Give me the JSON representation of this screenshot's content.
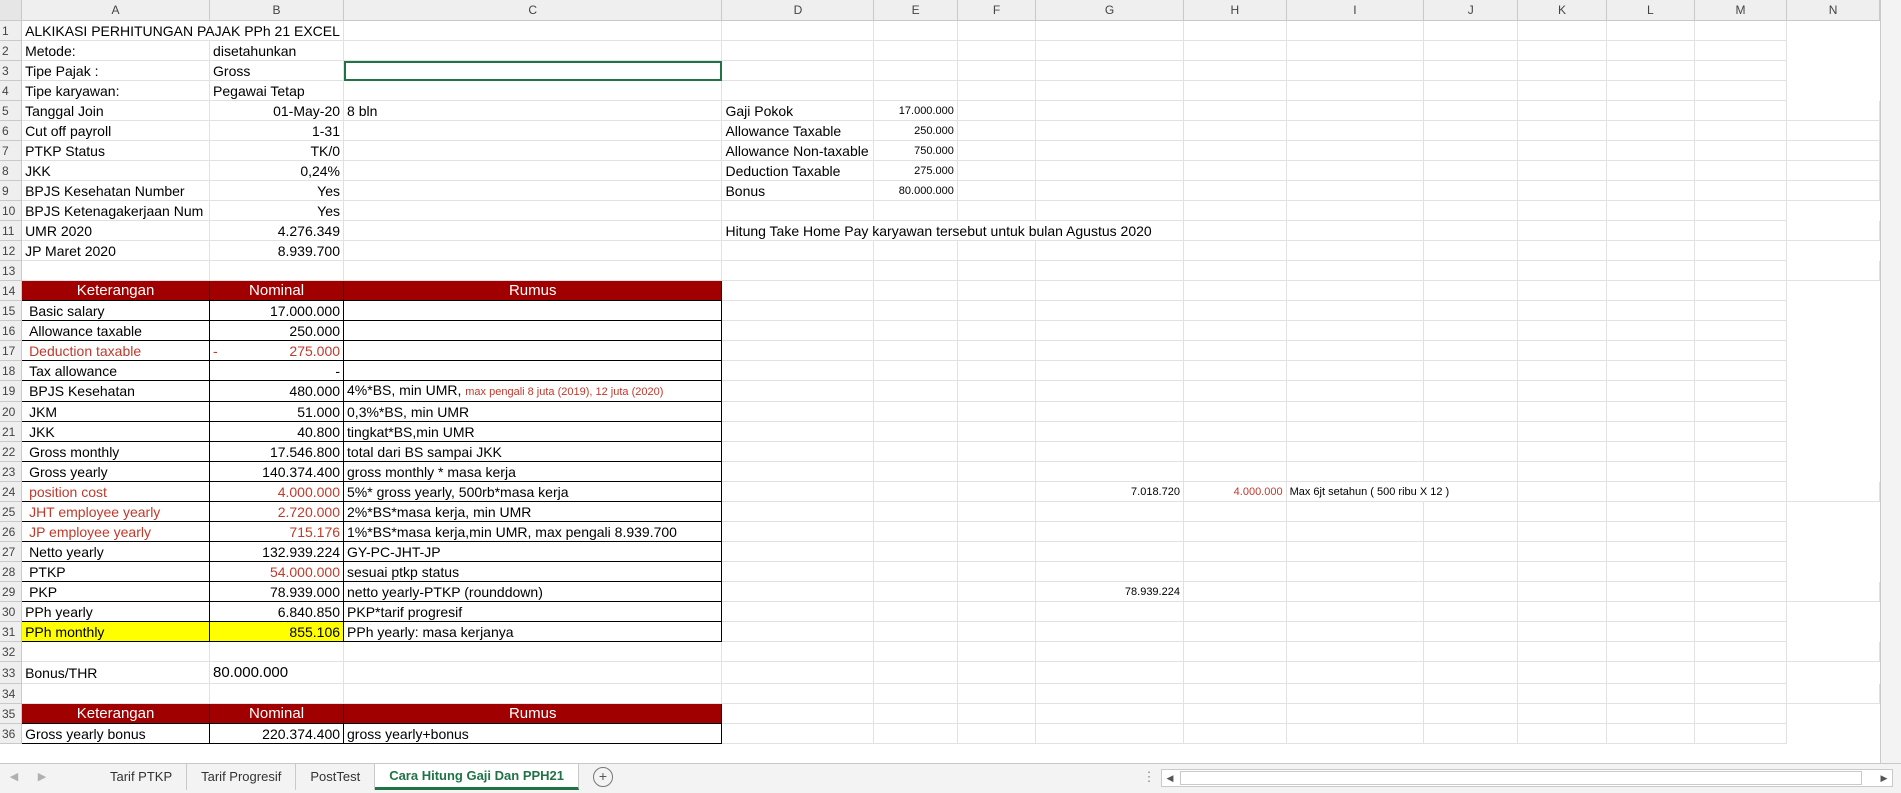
{
  "columns": [
    "A",
    "B",
    "C",
    "D",
    "E",
    "F",
    "G",
    "H",
    "I",
    "J",
    "K",
    "L",
    "M",
    "N"
  ],
  "rows": [
    "1",
    "2",
    "3",
    "4",
    "5",
    "6",
    "7",
    "8",
    "9",
    "10",
    "11",
    "12",
    "13",
    "14",
    "15",
    "16",
    "17",
    "18",
    "19",
    "20",
    "21",
    "22",
    "23",
    "24",
    "25",
    "26",
    "27",
    "28",
    "29",
    "30",
    "31",
    "32",
    "33",
    "34",
    "35",
    "36"
  ],
  "cells": {
    "r1": {
      "a": "ALKIKASI PERHITUNGAN PAJAK PPh 21 EXCEL"
    },
    "r2": {
      "a": "Metode:",
      "b": "disetahunkan"
    },
    "r3": {
      "a": "Tipe Pajak :",
      "b": "Gross"
    },
    "r4": {
      "a": "Tipe karyawan:",
      "b": "Pegawai Tetap"
    },
    "r5": {
      "a": "Tanggal Join",
      "b": "01-May-20",
      "c": "8 bln",
      "d": "Gaji Pokok",
      "e": "17.000.000"
    },
    "r6": {
      "a": "Cut off payroll",
      "b": "1-31",
      "d": "Allowance Taxable",
      "e": "250.000"
    },
    "r7": {
      "a": "PTKP Status",
      "b": "TK/0",
      "d": "Allowance Non-taxable",
      "e": "750.000"
    },
    "r8": {
      "a": "JKK",
      "b": "0,24%",
      "d": "Deduction Taxable",
      "e": "275.000"
    },
    "r9": {
      "a": "BPJS Kesehatan Number",
      "b": "Yes",
      "d": "Bonus",
      "e": "80.000.000"
    },
    "r10": {
      "a": "BPJS Ketenagakerjaan Num",
      "b": "Yes"
    },
    "r11": {
      "a": "UMR 2020",
      "b": "4.276.349",
      "d": "Hitung Take Home Pay karyawan tersebut untuk bulan Agustus 2020"
    },
    "r12": {
      "a": "JP Maret 2020",
      "b": "8.939.700"
    },
    "r14": {
      "a": "Keterangan",
      "b": "Nominal",
      "c": "Rumus"
    },
    "r15": {
      "a": "Basic salary",
      "b": "17.000.000"
    },
    "r16": {
      "a": "Allowance taxable",
      "b": "250.000"
    },
    "r17": {
      "a": "Deduction taxable",
      "bdash": "-",
      "b": "275.000"
    },
    "r18": {
      "a": "Tax allowance",
      "b": "-"
    },
    "r19": {
      "a": "BPJS Kesehatan",
      "b": "480.000",
      "c": "4%*BS, min UMR,",
      "c_red": "max pengali 8 juta (2019), 12 juta (2020)"
    },
    "r20": {
      "a": "JKM",
      "b": "51.000",
      "c": "0,3%*BS, min UMR"
    },
    "r21": {
      "a": "JKK",
      "b": "40.800",
      "c": "tingkat*BS,min UMR"
    },
    "r22": {
      "a": "Gross monthly",
      "b": "17.546.800",
      "c": "total dari BS sampai JKK"
    },
    "r23": {
      "a": "Gross yearly",
      "b": "140.374.400",
      "c": "gross monthly * masa kerja"
    },
    "r24": {
      "a": "position cost",
      "b": "4.000.000",
      "c": "5%* gross yearly, 500rb*masa kerja",
      "g": "7.018.720",
      "h": "4.000.000",
      "i": "Max 6jt setahun ( 500 ribu X 12 )"
    },
    "r25": {
      "a": "JHT employee yearly",
      "b": "2.720.000",
      "c": "2%*BS*masa kerja, min UMR"
    },
    "r26": {
      "a": "JP employee yearly",
      "b": "715.176",
      "c": "1%*BS*masa kerja,min UMR, max pengali 8.939.700"
    },
    "r27": {
      "a": "Netto yearly",
      "b": "132.939.224",
      "c": "GY-PC-JHT-JP"
    },
    "r28": {
      "a": "PTKP",
      "b": "54.000.000",
      "c": "sesuai ptkp status"
    },
    "r29": {
      "a": "PKP",
      "b": "78.939.000",
      "c": "netto yearly-PTKP (rounddown)",
      "g": "78.939.224"
    },
    "r30": {
      "a": "PPh yearly",
      "b": "6.840.850",
      "c": "PKP*tarif progresif"
    },
    "r31": {
      "a": "PPh monthly",
      "b": "855.106",
      "c": "PPh yearly: masa kerjanya"
    },
    "r33": {
      "a": "Bonus/THR",
      "b": "80.000.000"
    },
    "r35": {
      "a": "Keterangan",
      "b": "Nominal",
      "c": "Rumus"
    },
    "r36": {
      "a": "Gross yearly bonus",
      "b": "220.374.400",
      "c": "gross yearly+bonus"
    }
  },
  "tabs": [
    "Tarif PTKP",
    "Tarif Progresif",
    "PostTest",
    "Cara Hitung Gaji Dan PPH21"
  ],
  "active_tab": "Cara Hitung Gaji Dan PPH21",
  "colors": {
    "header_red": "#a00000",
    "highlight_yellow": "#ffff00",
    "excel_green": "#217346",
    "text_red": "#c0392b"
  }
}
